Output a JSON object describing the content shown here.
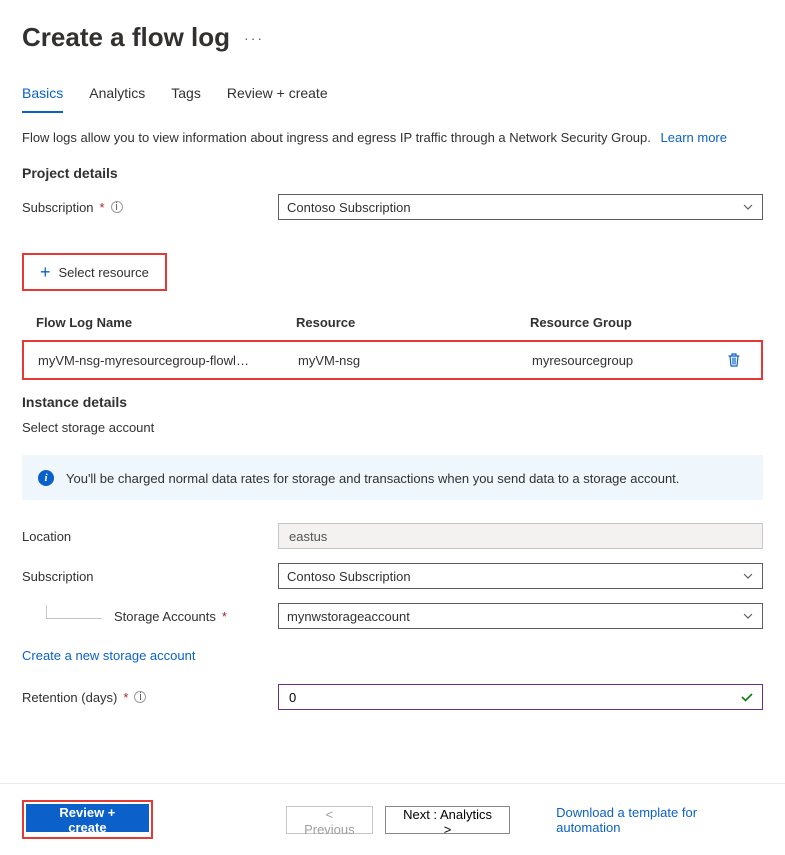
{
  "title": "Create a flow log",
  "tabs": [
    "Basics",
    "Analytics",
    "Tags",
    "Review + create"
  ],
  "active_tab": 0,
  "intro_text": "Flow logs allow you to view information about ingress and egress IP traffic through a Network Security Group.",
  "intro_link": "Learn more",
  "sections": {
    "project_details": "Project details",
    "instance_details": "Instance details",
    "select_storage": "Select storage account"
  },
  "fields": {
    "subscription_label": "Subscription",
    "subscription_value": "Contoso Subscription",
    "select_resource_label": "Select resource",
    "location_label": "Location",
    "location_value": "eastus",
    "subscription2_label": "Subscription",
    "subscription2_value": "Contoso Subscription",
    "storage_accounts_label": "Storage Accounts",
    "storage_accounts_value": "mynwstorageaccount",
    "create_storage_link": "Create a new storage account",
    "retention_label": "Retention (days)",
    "retention_value": "0"
  },
  "table": {
    "headers": {
      "name": "Flow Log Name",
      "resource": "Resource",
      "rg": "Resource Group"
    },
    "row": {
      "name": "myVM-nsg-myresourcegroup-flowl…",
      "resource": "myVM-nsg",
      "rg": "myresourcegroup"
    }
  },
  "banner": "You'll be charged normal data rates for storage and transactions when you send data to a storage account.",
  "footer": {
    "review": "Review + create",
    "previous": "< Previous",
    "next": "Next : Analytics >",
    "download": "Download a template for automation"
  }
}
